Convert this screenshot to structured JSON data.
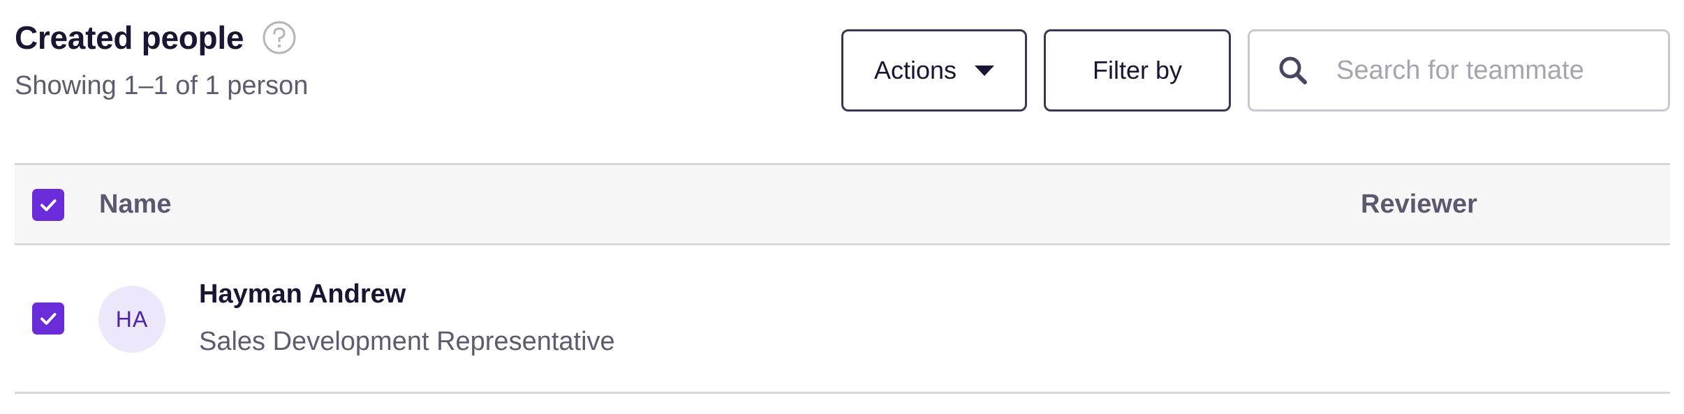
{
  "header": {
    "title": "Created people",
    "help_icon": "question-circle-icon",
    "subtitle": "Showing 1–1 of 1 person"
  },
  "toolbar": {
    "actions_label": "Actions",
    "actions_icon": "caret-down-icon",
    "filter_label": "Filter by",
    "search_placeholder": "Search for teammate",
    "search_value": "",
    "search_icon": "search-icon"
  },
  "table": {
    "select_all_checked": true,
    "columns": [
      "Name",
      "Reviewer"
    ],
    "rows": [
      {
        "checked": true,
        "initials": "HA",
        "name": "Hayman Andrew",
        "job_title": "Sales Development Representative",
        "reviewer": ""
      }
    ]
  },
  "colors": {
    "accent": "#6a2bd9",
    "avatar_bg": "#ece7fb",
    "avatar_text": "#4f23a8",
    "header_bg": "#f7f7f7",
    "text_primary": "#1b1432",
    "text_secondary": "#5e5a70"
  }
}
